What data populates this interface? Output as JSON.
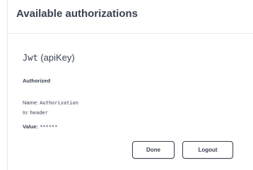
{
  "modal": {
    "title": "Available authorizations"
  },
  "auth": {
    "scheme_name": "Jwt",
    "scheme_type": "(apiKey)",
    "status": "Authorized",
    "name_label": "Name:",
    "name_value": "Authorization",
    "in_label": "In:",
    "in_value": "header",
    "value_label": "Value:",
    "value_masked": "******"
  },
  "buttons": {
    "done_label": "Done",
    "logout_label": "Logout"
  },
  "colors": {
    "text": "#3b4151",
    "border": "#3b4151",
    "divider": "#ebebeb",
    "background": "#ffffff"
  }
}
